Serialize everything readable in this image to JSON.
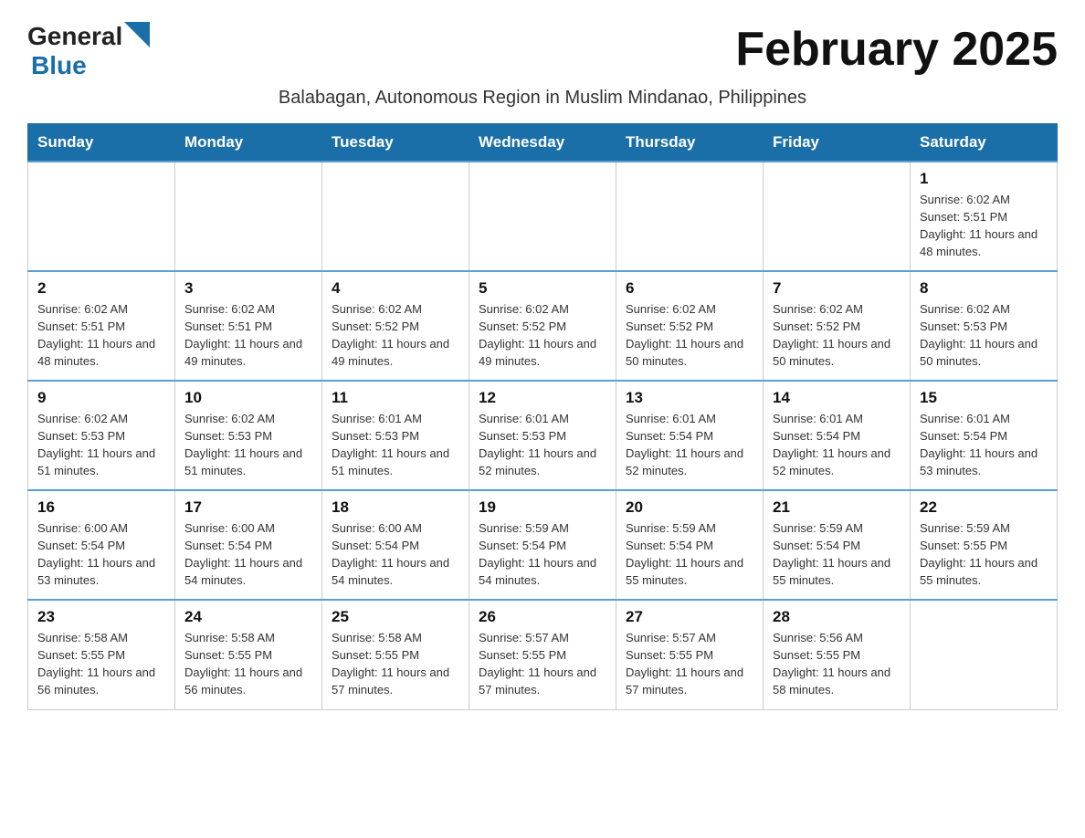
{
  "header": {
    "logo_general": "General",
    "logo_blue": "Blue",
    "title": "February 2025",
    "subtitle": "Balabagan, Autonomous Region in Muslim Mindanao, Philippines"
  },
  "calendar": {
    "days_of_week": [
      "Sunday",
      "Monday",
      "Tuesday",
      "Wednesday",
      "Thursday",
      "Friday",
      "Saturday"
    ],
    "weeks": [
      [
        {
          "day": "",
          "info": ""
        },
        {
          "day": "",
          "info": ""
        },
        {
          "day": "",
          "info": ""
        },
        {
          "day": "",
          "info": ""
        },
        {
          "day": "",
          "info": ""
        },
        {
          "day": "",
          "info": ""
        },
        {
          "day": "1",
          "info": "Sunrise: 6:02 AM\nSunset: 5:51 PM\nDaylight: 11 hours and 48 minutes."
        }
      ],
      [
        {
          "day": "2",
          "info": "Sunrise: 6:02 AM\nSunset: 5:51 PM\nDaylight: 11 hours and 48 minutes."
        },
        {
          "day": "3",
          "info": "Sunrise: 6:02 AM\nSunset: 5:51 PM\nDaylight: 11 hours and 49 minutes."
        },
        {
          "day": "4",
          "info": "Sunrise: 6:02 AM\nSunset: 5:52 PM\nDaylight: 11 hours and 49 minutes."
        },
        {
          "day": "5",
          "info": "Sunrise: 6:02 AM\nSunset: 5:52 PM\nDaylight: 11 hours and 49 minutes."
        },
        {
          "day": "6",
          "info": "Sunrise: 6:02 AM\nSunset: 5:52 PM\nDaylight: 11 hours and 50 minutes."
        },
        {
          "day": "7",
          "info": "Sunrise: 6:02 AM\nSunset: 5:52 PM\nDaylight: 11 hours and 50 minutes."
        },
        {
          "day": "8",
          "info": "Sunrise: 6:02 AM\nSunset: 5:53 PM\nDaylight: 11 hours and 50 minutes."
        }
      ],
      [
        {
          "day": "9",
          "info": "Sunrise: 6:02 AM\nSunset: 5:53 PM\nDaylight: 11 hours and 51 minutes."
        },
        {
          "day": "10",
          "info": "Sunrise: 6:02 AM\nSunset: 5:53 PM\nDaylight: 11 hours and 51 minutes."
        },
        {
          "day": "11",
          "info": "Sunrise: 6:01 AM\nSunset: 5:53 PM\nDaylight: 11 hours and 51 minutes."
        },
        {
          "day": "12",
          "info": "Sunrise: 6:01 AM\nSunset: 5:53 PM\nDaylight: 11 hours and 52 minutes."
        },
        {
          "day": "13",
          "info": "Sunrise: 6:01 AM\nSunset: 5:54 PM\nDaylight: 11 hours and 52 minutes."
        },
        {
          "day": "14",
          "info": "Sunrise: 6:01 AM\nSunset: 5:54 PM\nDaylight: 11 hours and 52 minutes."
        },
        {
          "day": "15",
          "info": "Sunrise: 6:01 AM\nSunset: 5:54 PM\nDaylight: 11 hours and 53 minutes."
        }
      ],
      [
        {
          "day": "16",
          "info": "Sunrise: 6:00 AM\nSunset: 5:54 PM\nDaylight: 11 hours and 53 minutes."
        },
        {
          "day": "17",
          "info": "Sunrise: 6:00 AM\nSunset: 5:54 PM\nDaylight: 11 hours and 54 minutes."
        },
        {
          "day": "18",
          "info": "Sunrise: 6:00 AM\nSunset: 5:54 PM\nDaylight: 11 hours and 54 minutes."
        },
        {
          "day": "19",
          "info": "Sunrise: 5:59 AM\nSunset: 5:54 PM\nDaylight: 11 hours and 54 minutes."
        },
        {
          "day": "20",
          "info": "Sunrise: 5:59 AM\nSunset: 5:54 PM\nDaylight: 11 hours and 55 minutes."
        },
        {
          "day": "21",
          "info": "Sunrise: 5:59 AM\nSunset: 5:54 PM\nDaylight: 11 hours and 55 minutes."
        },
        {
          "day": "22",
          "info": "Sunrise: 5:59 AM\nSunset: 5:55 PM\nDaylight: 11 hours and 55 minutes."
        }
      ],
      [
        {
          "day": "23",
          "info": "Sunrise: 5:58 AM\nSunset: 5:55 PM\nDaylight: 11 hours and 56 minutes."
        },
        {
          "day": "24",
          "info": "Sunrise: 5:58 AM\nSunset: 5:55 PM\nDaylight: 11 hours and 56 minutes."
        },
        {
          "day": "25",
          "info": "Sunrise: 5:58 AM\nSunset: 5:55 PM\nDaylight: 11 hours and 57 minutes."
        },
        {
          "day": "26",
          "info": "Sunrise: 5:57 AM\nSunset: 5:55 PM\nDaylight: 11 hours and 57 minutes."
        },
        {
          "day": "27",
          "info": "Sunrise: 5:57 AM\nSunset: 5:55 PM\nDaylight: 11 hours and 57 minutes."
        },
        {
          "day": "28",
          "info": "Sunrise: 5:56 AM\nSunset: 5:55 PM\nDaylight: 11 hours and 58 minutes."
        },
        {
          "day": "",
          "info": ""
        }
      ]
    ]
  }
}
